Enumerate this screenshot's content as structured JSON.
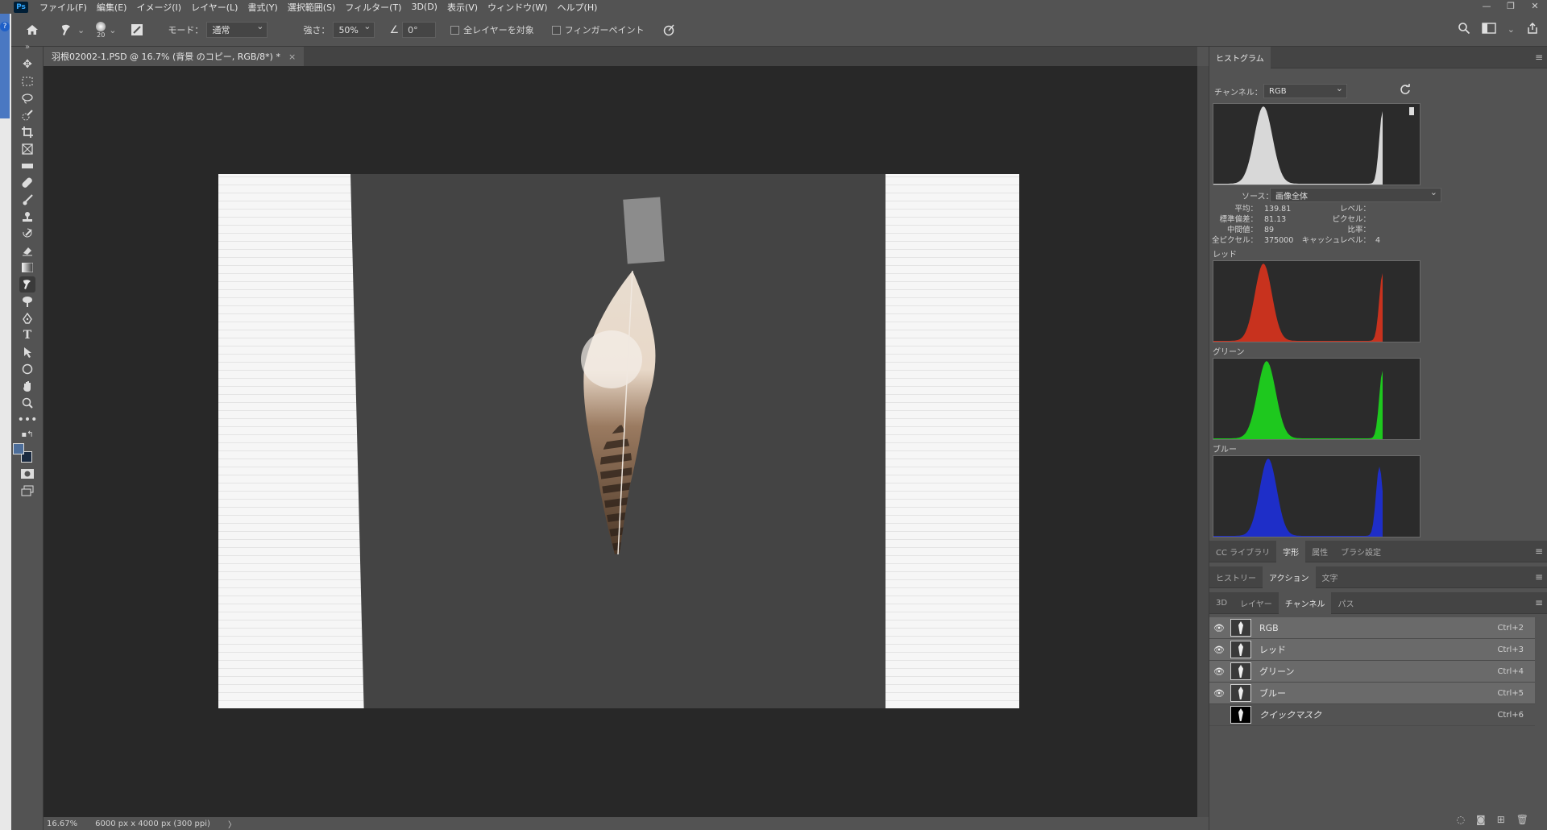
{
  "app": {
    "logo": "Ps",
    "menus": [
      "ファイル(F)",
      "編集(E)",
      "イメージ(I)",
      "レイヤー(L)",
      "書式(Y)",
      "選択範囲(S)",
      "フィルター(T)",
      "3D(D)",
      "表示(V)",
      "ウィンドウ(W)",
      "ヘルプ(H)"
    ],
    "window_controls": [
      "—",
      "❐",
      "✕"
    ]
  },
  "options": {
    "brush_size": "20",
    "mode_label": "モード：",
    "mode_value": "通常",
    "strength_label": "強さ：",
    "strength_value": "50%",
    "angle_value": "0°",
    "all_layers_label": "全レイヤーを対象",
    "finger_paint_label": "フィンガーペイント"
  },
  "document": {
    "tab_title": "羽根02002-1.PSD @ 16.7% (背景 のコピー, RGB/8*) *",
    "tab_close": "×"
  },
  "status": {
    "zoom": "16.67%",
    "doc_info": "6000 px x 4000 px (300 ppi)",
    "arrow": "〉"
  },
  "histogram": {
    "tab": "ヒストグラム",
    "channel_label": "チャンネル：",
    "channel_value": "RGB",
    "source_label": "ソース：",
    "source_value": "画像全体",
    "stats_left": [
      {
        "k": "平均：",
        "v": "139.81"
      },
      {
        "k": "標準偏差：",
        "v": "81.13"
      },
      {
        "k": "中間値：",
        "v": "89"
      },
      {
        "k": "全ピクセル：",
        "v": "375000"
      }
    ],
    "stats_right": [
      {
        "k": "レベル：",
        "v": ""
      },
      {
        "k": "ピクセル：",
        "v": ""
      },
      {
        "k": "比率：",
        "v": ""
      },
      {
        "k": "キャッシュレベル：",
        "v": "4"
      }
    ],
    "red_label": "レッド",
    "green_label": "グリーン",
    "blue_label": "ブルー",
    "colors": {
      "rgb": "#d8d8d8",
      "red": "#c8321e",
      "green": "#1ec81e",
      "blue": "#1e2ec8"
    }
  },
  "panel_tabs_1": [
    "CC ライブラリ",
    "字形",
    "属性",
    "ブラシ設定"
  ],
  "panel_tabs_2": [
    "ヒストリー",
    "アクション",
    "文字"
  ],
  "panel_tabs_3": [
    "3D",
    "レイヤー",
    "チャンネル",
    "パス"
  ],
  "channels": [
    {
      "name": "RGB",
      "key": "Ctrl+2"
    },
    {
      "name": "レッド",
      "key": "Ctrl+3"
    },
    {
      "name": "グリーン",
      "key": "Ctrl+4"
    },
    {
      "name": "ブルー",
      "key": "Ctrl+5"
    },
    {
      "name": "クイックマスク",
      "key": "Ctrl+6"
    }
  ]
}
